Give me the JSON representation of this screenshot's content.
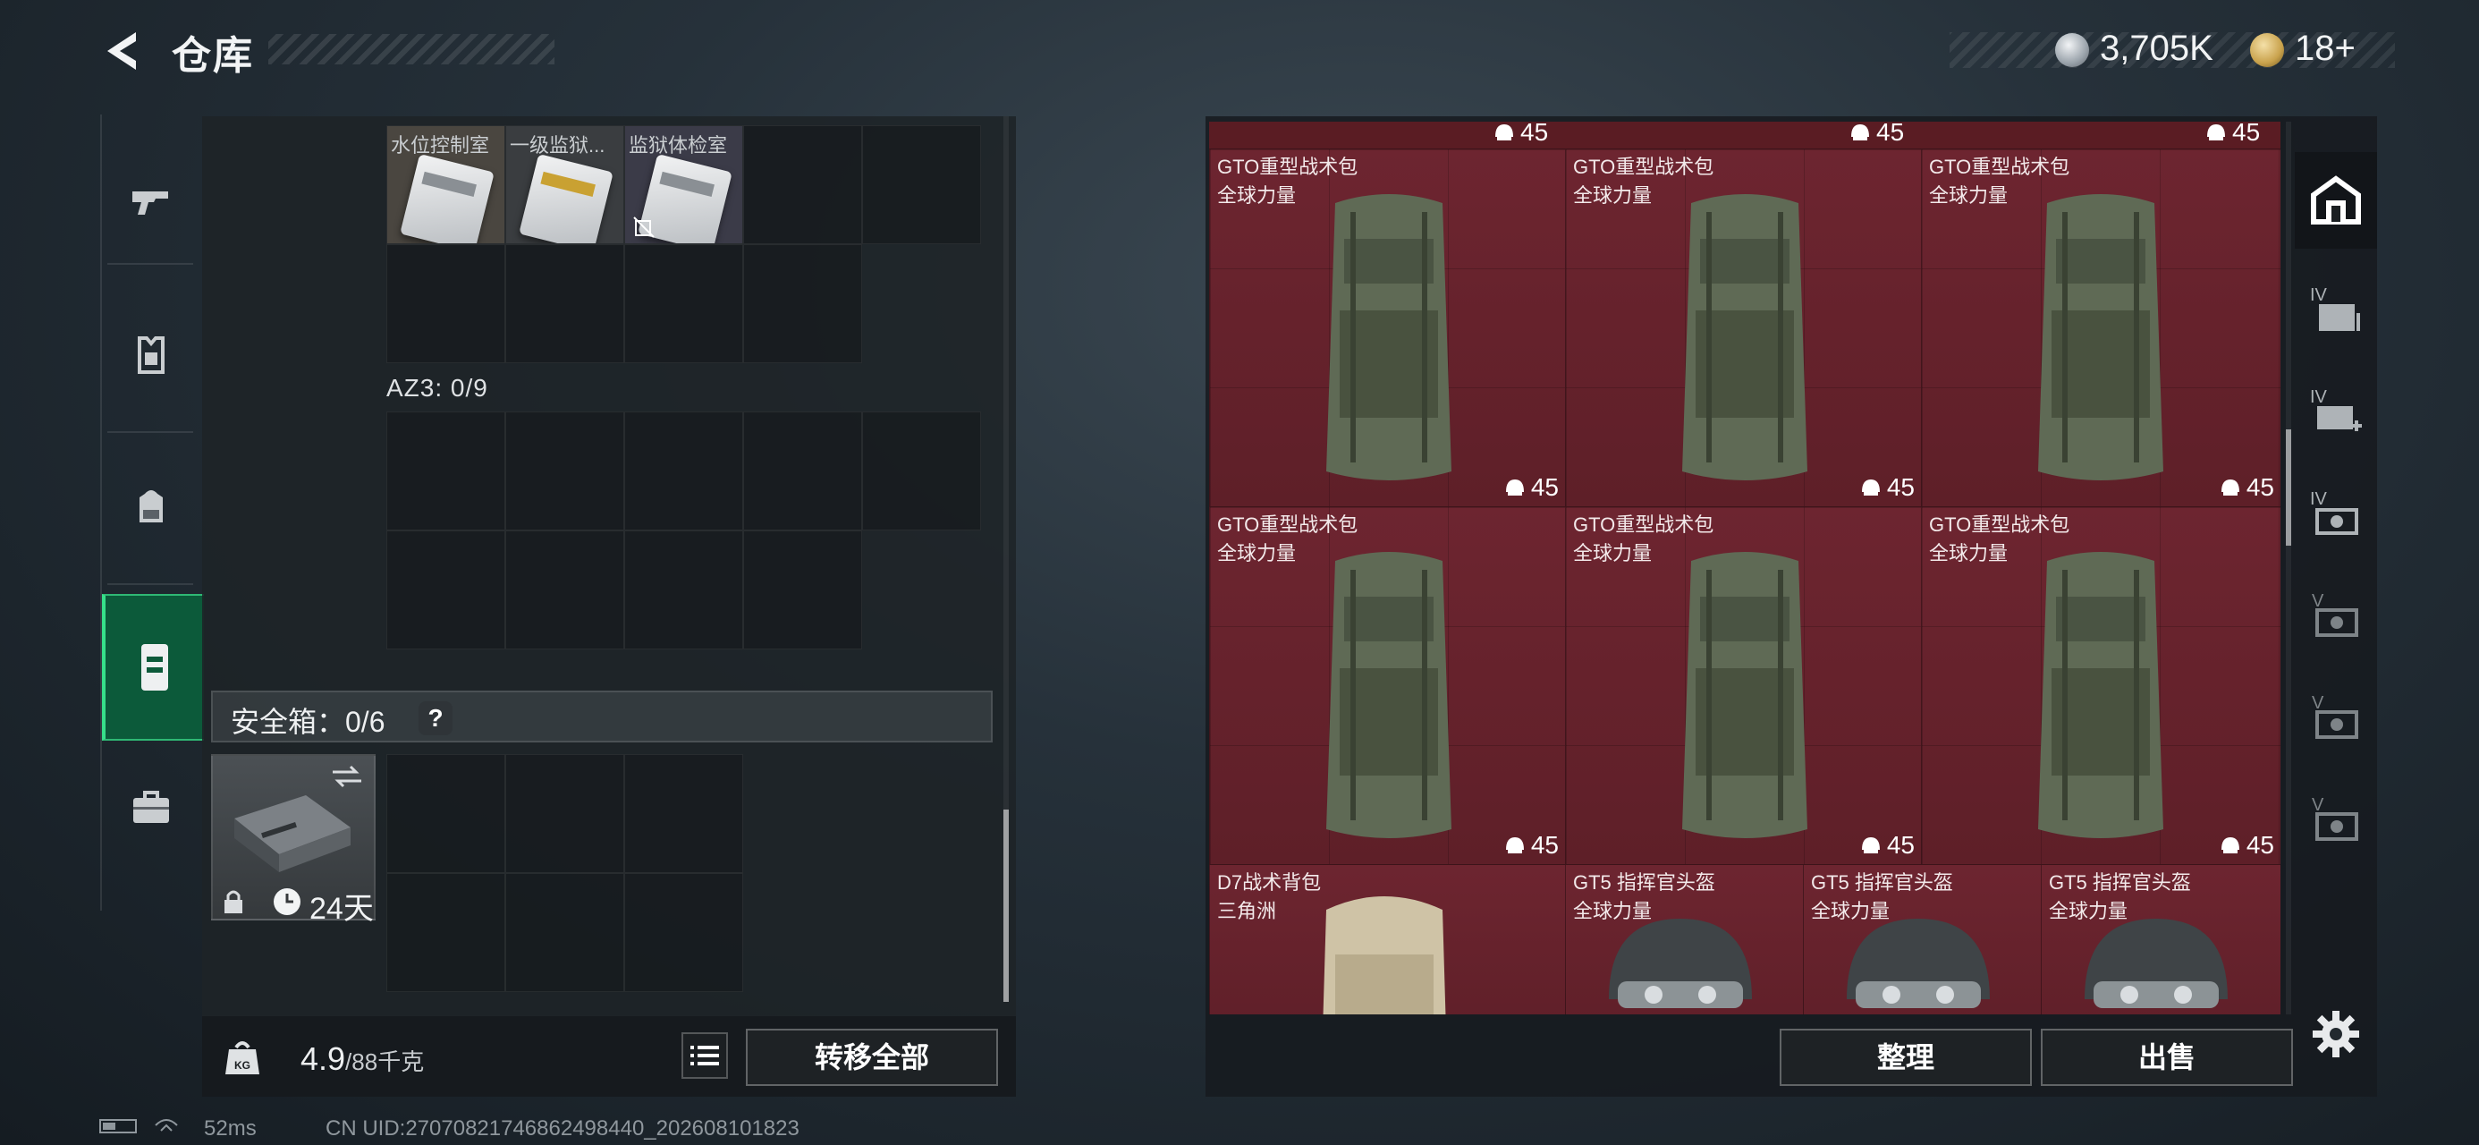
{
  "header": {
    "title": "仓库",
    "currency_1": "3,705K",
    "currency_2": "18+"
  },
  "left_nav": [
    "gun-icon",
    "armor-icon",
    "backpack-icon",
    "rig-icon",
    "case-icon"
  ],
  "container": {
    "top_items": [
      {
        "label": "水位控制室"
      },
      {
        "label": "一级监狱..."
      },
      {
        "label": "监狱体检室"
      }
    ],
    "az3_label": "AZ3: 0/9",
    "safe_box_label": "安全箱：0/6",
    "safe_help": "?",
    "safe_case_days": "24天",
    "weight_value": "4.9",
    "weight_unit": "/88千克",
    "kg_label": "KG",
    "transfer_all": "转移全部"
  },
  "stash": {
    "top_counts": [
      "45",
      "45",
      "45"
    ],
    "tiles": [
      {
        "name": "GTO重型战术包",
        "desc": "全球力量",
        "count": "45"
      },
      {
        "name": "GTO重型战术包",
        "desc": "全球力量",
        "count": "45"
      },
      {
        "name": "GTO重型战术包",
        "desc": "全球力量",
        "count": "45"
      },
      {
        "name": "GTO重型战术包",
        "desc": "全球力量",
        "count": "45"
      },
      {
        "name": "GTO重型战术包",
        "desc": "全球力量",
        "count": "45"
      },
      {
        "name": "GTO重型战术包",
        "desc": "全球力量",
        "count": "45"
      },
      {
        "name": "D7战术背包",
        "desc": "三角洲"
      },
      {
        "name": "GT5 指挥官头盔",
        "desc": "全球力量"
      },
      {
        "name": "GT5 指挥官头盔",
        "desc": "全球力量"
      },
      {
        "name": "GT5 指挥官头盔",
        "desc": "全球力量"
      }
    ],
    "sort_button": "整理",
    "sell_button": "出售"
  },
  "right_tabs": [
    "main-stash-icon",
    "IV",
    "IV",
    "IV",
    "V",
    "V",
    "V"
  ],
  "status": {
    "ping": "52ms",
    "uid": "CN UID:2707082174686249844​0_202608101823"
  },
  "colors": {
    "accent_green": "#36e08a",
    "stash_red": "#6d2530"
  }
}
